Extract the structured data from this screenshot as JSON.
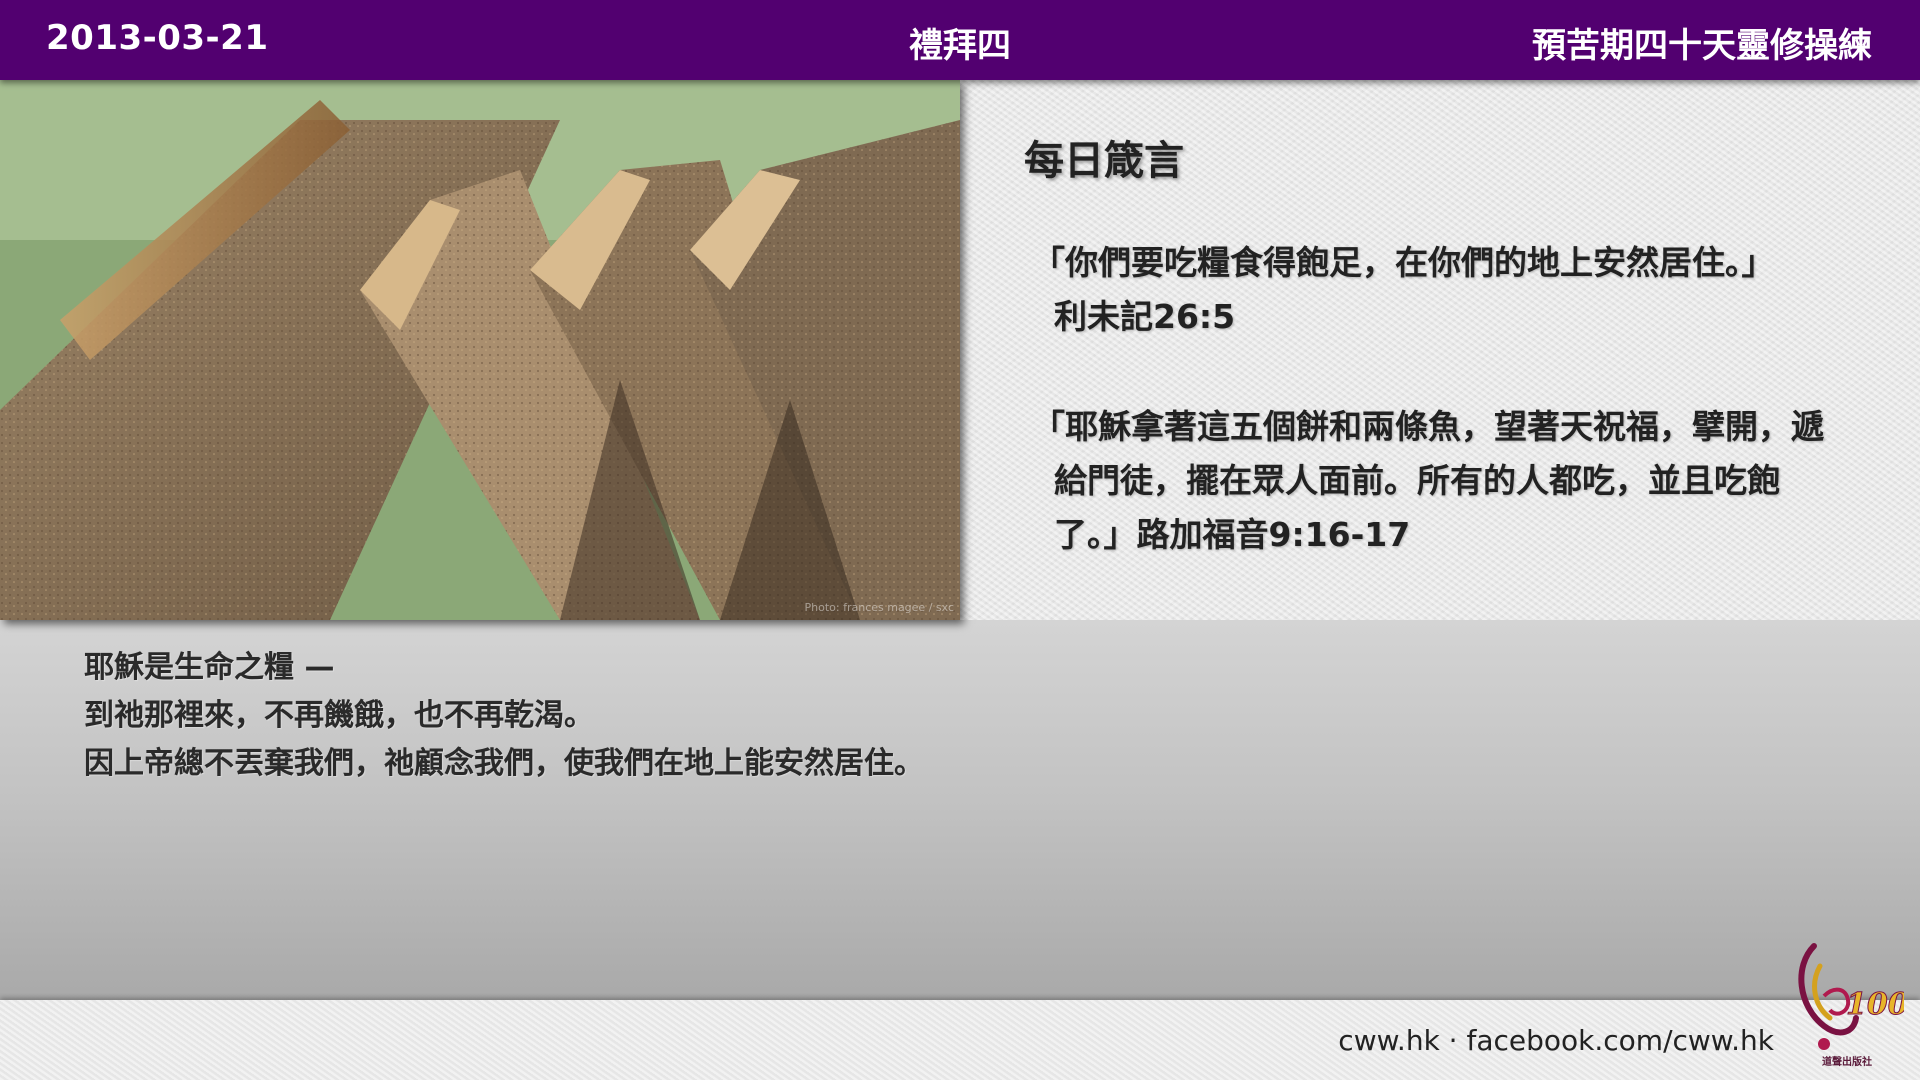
{
  "header": {
    "date": "2013-03-21",
    "day": "禮拜四",
    "series": "預苦期四十天靈修操練"
  },
  "photo": {
    "credit": "Photo: frances magee / sxc"
  },
  "verses": {
    "title": "每日箴言",
    "items": [
      {
        "quote": "「你們要吃糧食得飽足，在你們的地上安然居住。」",
        "ref": "利未記26:5"
      },
      {
        "quote": "「耶穌拿著這五個餅和兩條魚，望著天祝福，擘開，遞給門徒，擺在眾人面前。所有的人都吃，並且吃飽了。」",
        "ref": "路加福音9:16-17"
      }
    ]
  },
  "reflection": {
    "lines": [
      "耶穌是生命之糧 —",
      "到祂那裡來，不再饑餓，也不再乾渴。",
      "因上帝總不丟棄我們，祂顧念我們，使我們在地上能安然居住。"
    ]
  },
  "footer": {
    "site": "cww.hk · facebook.com/cww.hk",
    "logo_text": "100",
    "publisher": "道聲出版社"
  },
  "colors": {
    "header_bg": "#520070",
    "header_text": "#ffffff",
    "body_text": "#222222"
  }
}
